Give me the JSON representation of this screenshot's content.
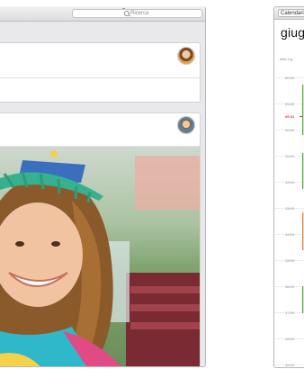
{
  "left_window": {
    "search": {
      "placeholder": "Ricerca"
    }
  },
  "right_window": {
    "toolbar": {
      "calendar_label": "Calendari"
    },
    "month_title": "giug",
    "all_day_label": "tutto il g.",
    "hours": [
      "06:00",
      "09:00",
      "10:00",
      "11:00",
      "12:00",
      "13:00",
      "14:00",
      "15:00",
      "16:00",
      "17:00",
      "18:00",
      "19:00"
    ],
    "current_time": "09:41",
    "colors": {
      "now": "#e0342c",
      "event_green": "#5aa844",
      "event_orange": "#e7833a"
    }
  }
}
